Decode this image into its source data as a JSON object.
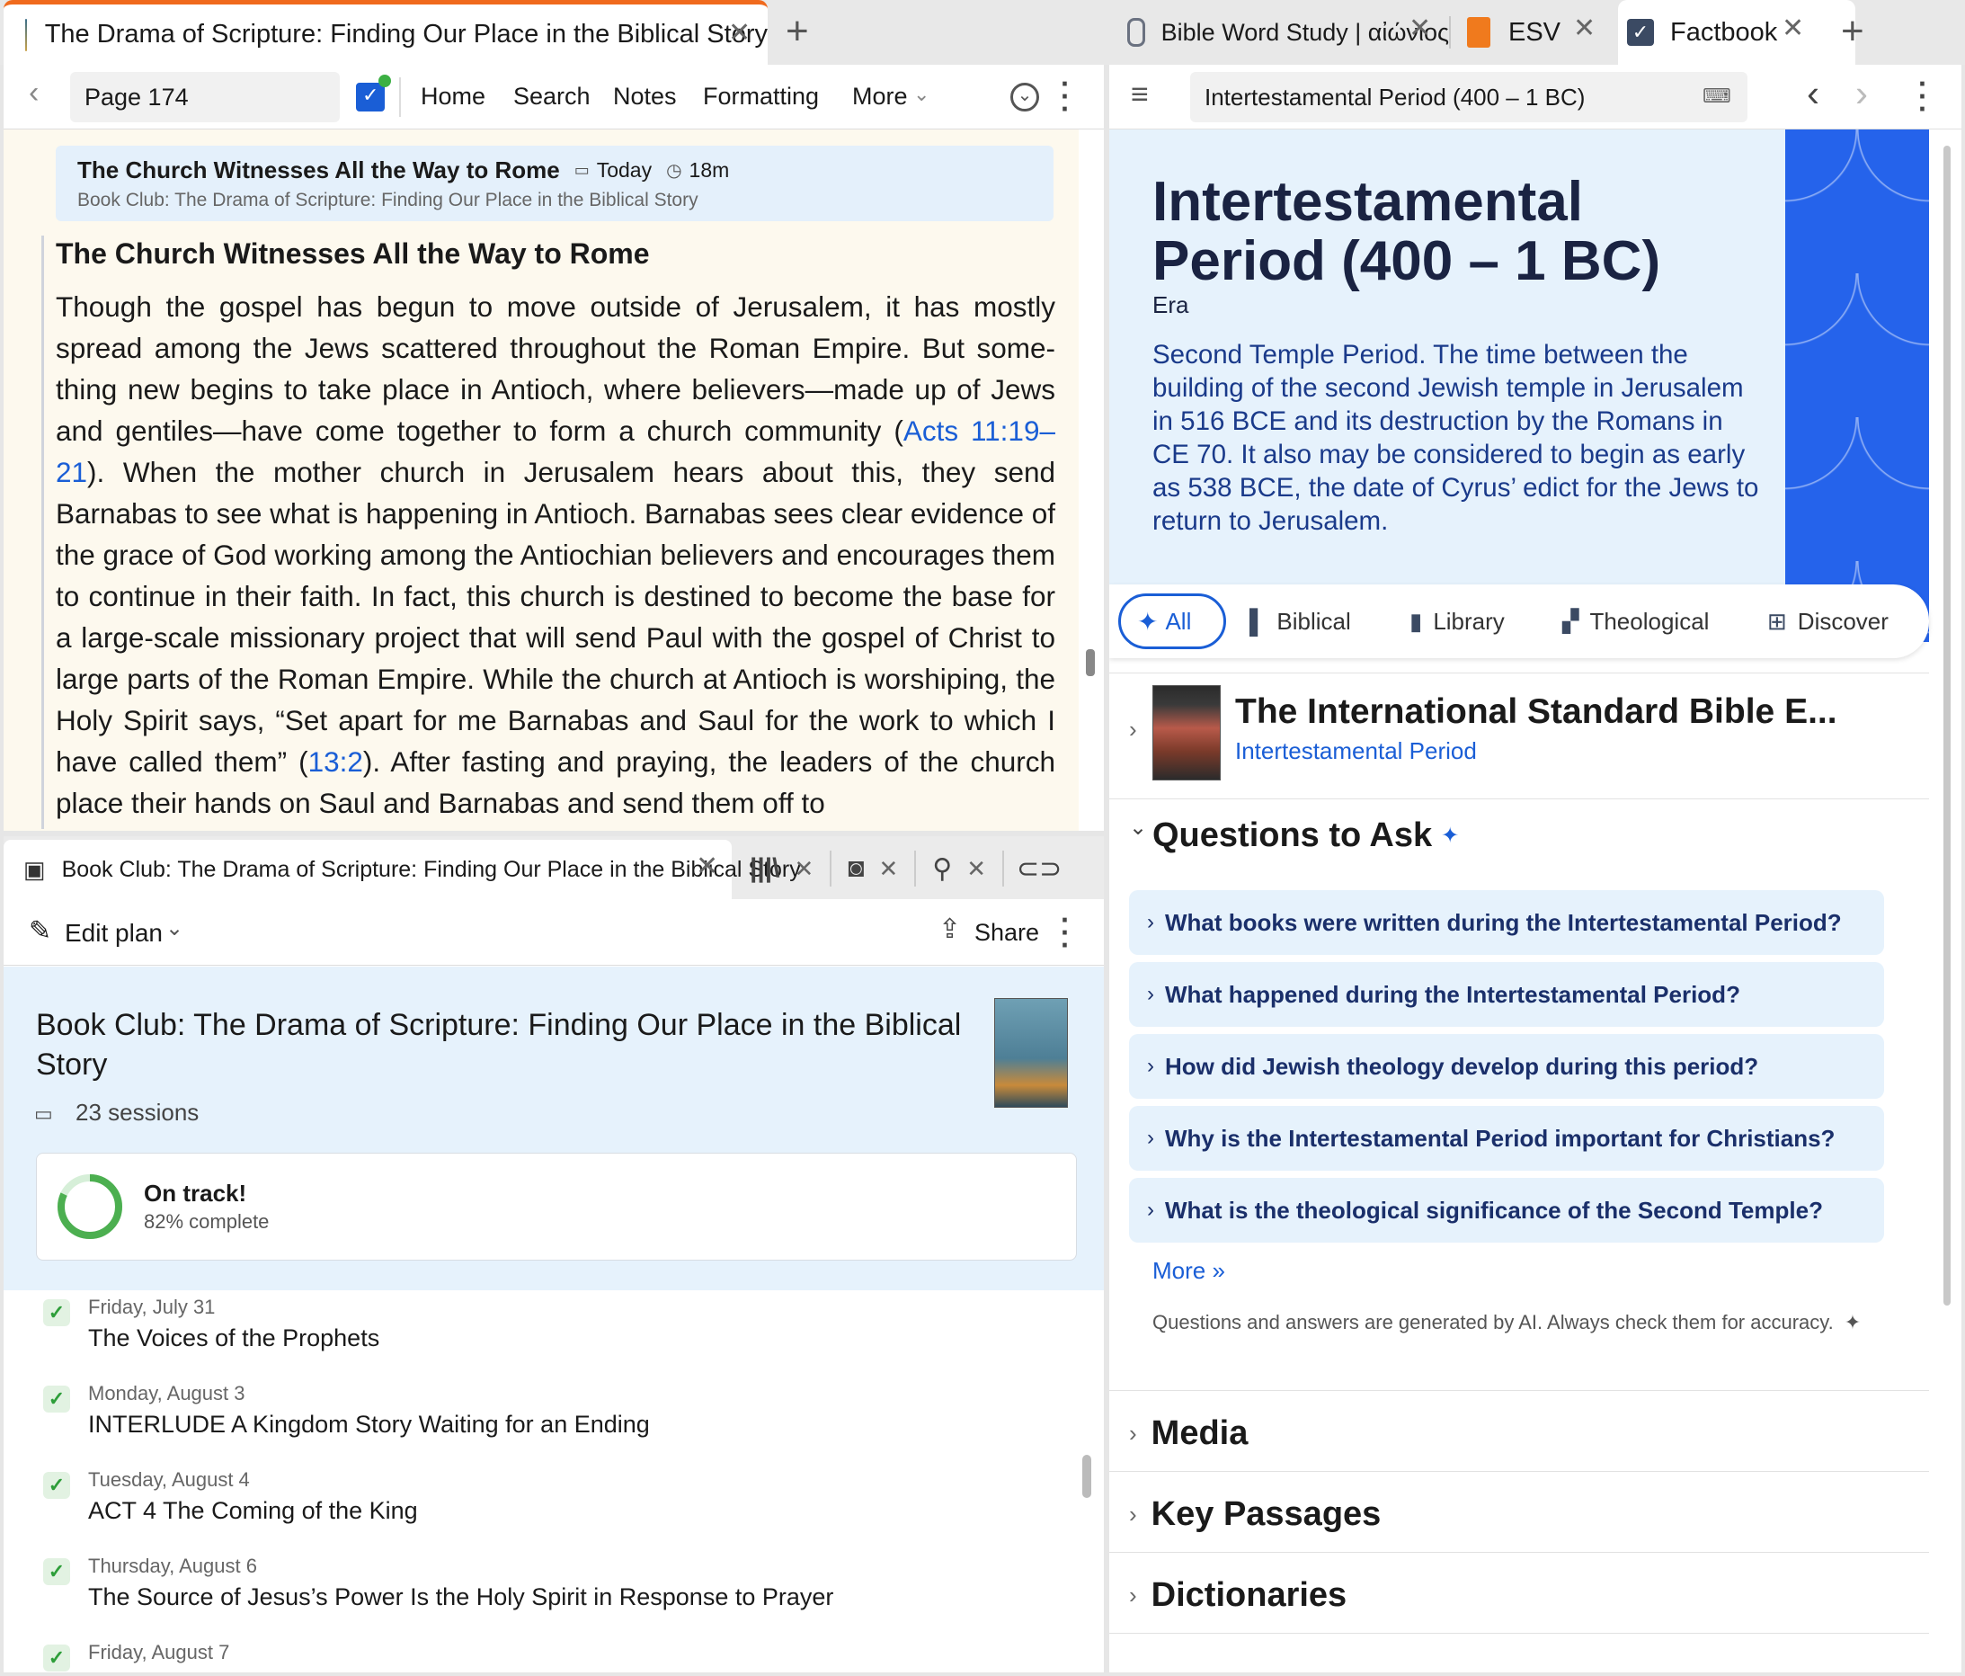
{
  "left_tab": {
    "title": "The Drama of Scripture: Finding Our Place in the Biblical Story"
  },
  "right_tabs": [
    {
      "title": "Bible Word Study | αἰώνιος"
    },
    {
      "title": "ESV"
    },
    {
      "title": "Factbook"
    }
  ],
  "reader_toolbar": {
    "page": "Page 174",
    "menu": [
      "Home",
      "Search",
      "Notes",
      "Formatting",
      "More"
    ]
  },
  "reading_card": {
    "title": "The Church Witnesses All the Way to Rome",
    "date": "Today",
    "duration": "18m",
    "subtitle": "Book Club: The Drama of Scripture: Finding Our Place in the Biblical Story"
  },
  "reader": {
    "heading": "The Church Witnesses All the Way to Rome",
    "p1": "Though the gospel has begun to move outside of Jerusalem, it has mostly spread among the Jews scattered throughout the Roman Empire. But some-thing new begins to take place in Antioch, where believers—made up of Jews and gentiles—have come together to form a church community (",
    "link1": "Acts 11:19–21",
    "p2": "). When the mother church in Jerusalem hears about this, they send Barnabas to see what is happening in Antioch. Barnabas sees clear evidence of the grace of God working among the Antiochian believers and encourages them to continue in their faith. In fact, this church is destined to become the base for a large-scale missionary project that will send Paul with the gospel of Christ to large parts of the Roman Empire. While the church at Antioch is worshiping, the Holy Spirit says, “Set apart for me Barnabas and Saul for the work to which I have called them” (",
    "link2": "13:2",
    "p3": "). After fasting and praying, the leaders of the church place their hands on Saul and Barnabas and send them off to"
  },
  "bottom_tab": {
    "title": "Book Club: The Drama of Scripture: Finding Our Place in the Biblical Story"
  },
  "plan_toolbar": {
    "edit": "Edit plan",
    "share": "Share"
  },
  "plan": {
    "title": "Book Club: The Drama of Scripture: Finding Our Place in the Biblical Story",
    "sessions": "23 sessions",
    "status": "On track!",
    "progress_text": "82% complete",
    "progress": 0.82,
    "items": [
      {
        "date": "Friday, July 31",
        "title": "The Voices of the Prophets"
      },
      {
        "date": "Monday, August 3",
        "title": "INTERLUDE A Kingdom Story Waiting for an Ending"
      },
      {
        "date": "Tuesday, August 4",
        "title": "ACT 4 The Coming of the King"
      },
      {
        "date": "Thursday, August 6",
        "title": "The Source of Jesus’s Power Is the Holy Spirit in Response to Prayer"
      },
      {
        "date": "Friday, August 7",
        "title": ""
      }
    ]
  },
  "factbook_toolbar": {
    "search": "Intertestamental Period (400 – 1 BC)"
  },
  "factbook": {
    "title_line1": "Intertestamental",
    "title_line2": "Period (400 – 1 BC)",
    "type": "Era",
    "description": "Second Temple Period. The time between the building of the second Jewish temple in Jerusalem in 516 BCE and its destruction by the Romans in CE 70. It also may be considered to begin as early as 538 BCE, the date of Cyrus’ edict for the Jews to return to Jerusalem.",
    "filters": [
      "All",
      "Biblical",
      "Library",
      "Theological",
      "Discover"
    ],
    "resource_title": "The International Standard Bible E...",
    "resource_sub": "Intertestamental Period",
    "questions_heading": "Questions to Ask",
    "questions": [
      "What books were written during the Intertestamental Period?",
      "What happened during the Intertestamental Period?",
      "How did Jewish theology develop during this period?",
      "Why is the Intertestamental Period important for Christians?",
      "What is the theological significance of the Second Temple?"
    ],
    "more": "More »",
    "ai_note": "Questions and answers are generated by AI. Always check them for accuracy.",
    "sections": [
      "Media",
      "Key Passages",
      "Dictionaries"
    ]
  },
  "colors": {
    "accent": "#1a5ed6",
    "tab_active": "#f06a1d",
    "progress": "#4caf50",
    "hero_bg": "#e6f2fc",
    "pattern": "#2563eb"
  }
}
